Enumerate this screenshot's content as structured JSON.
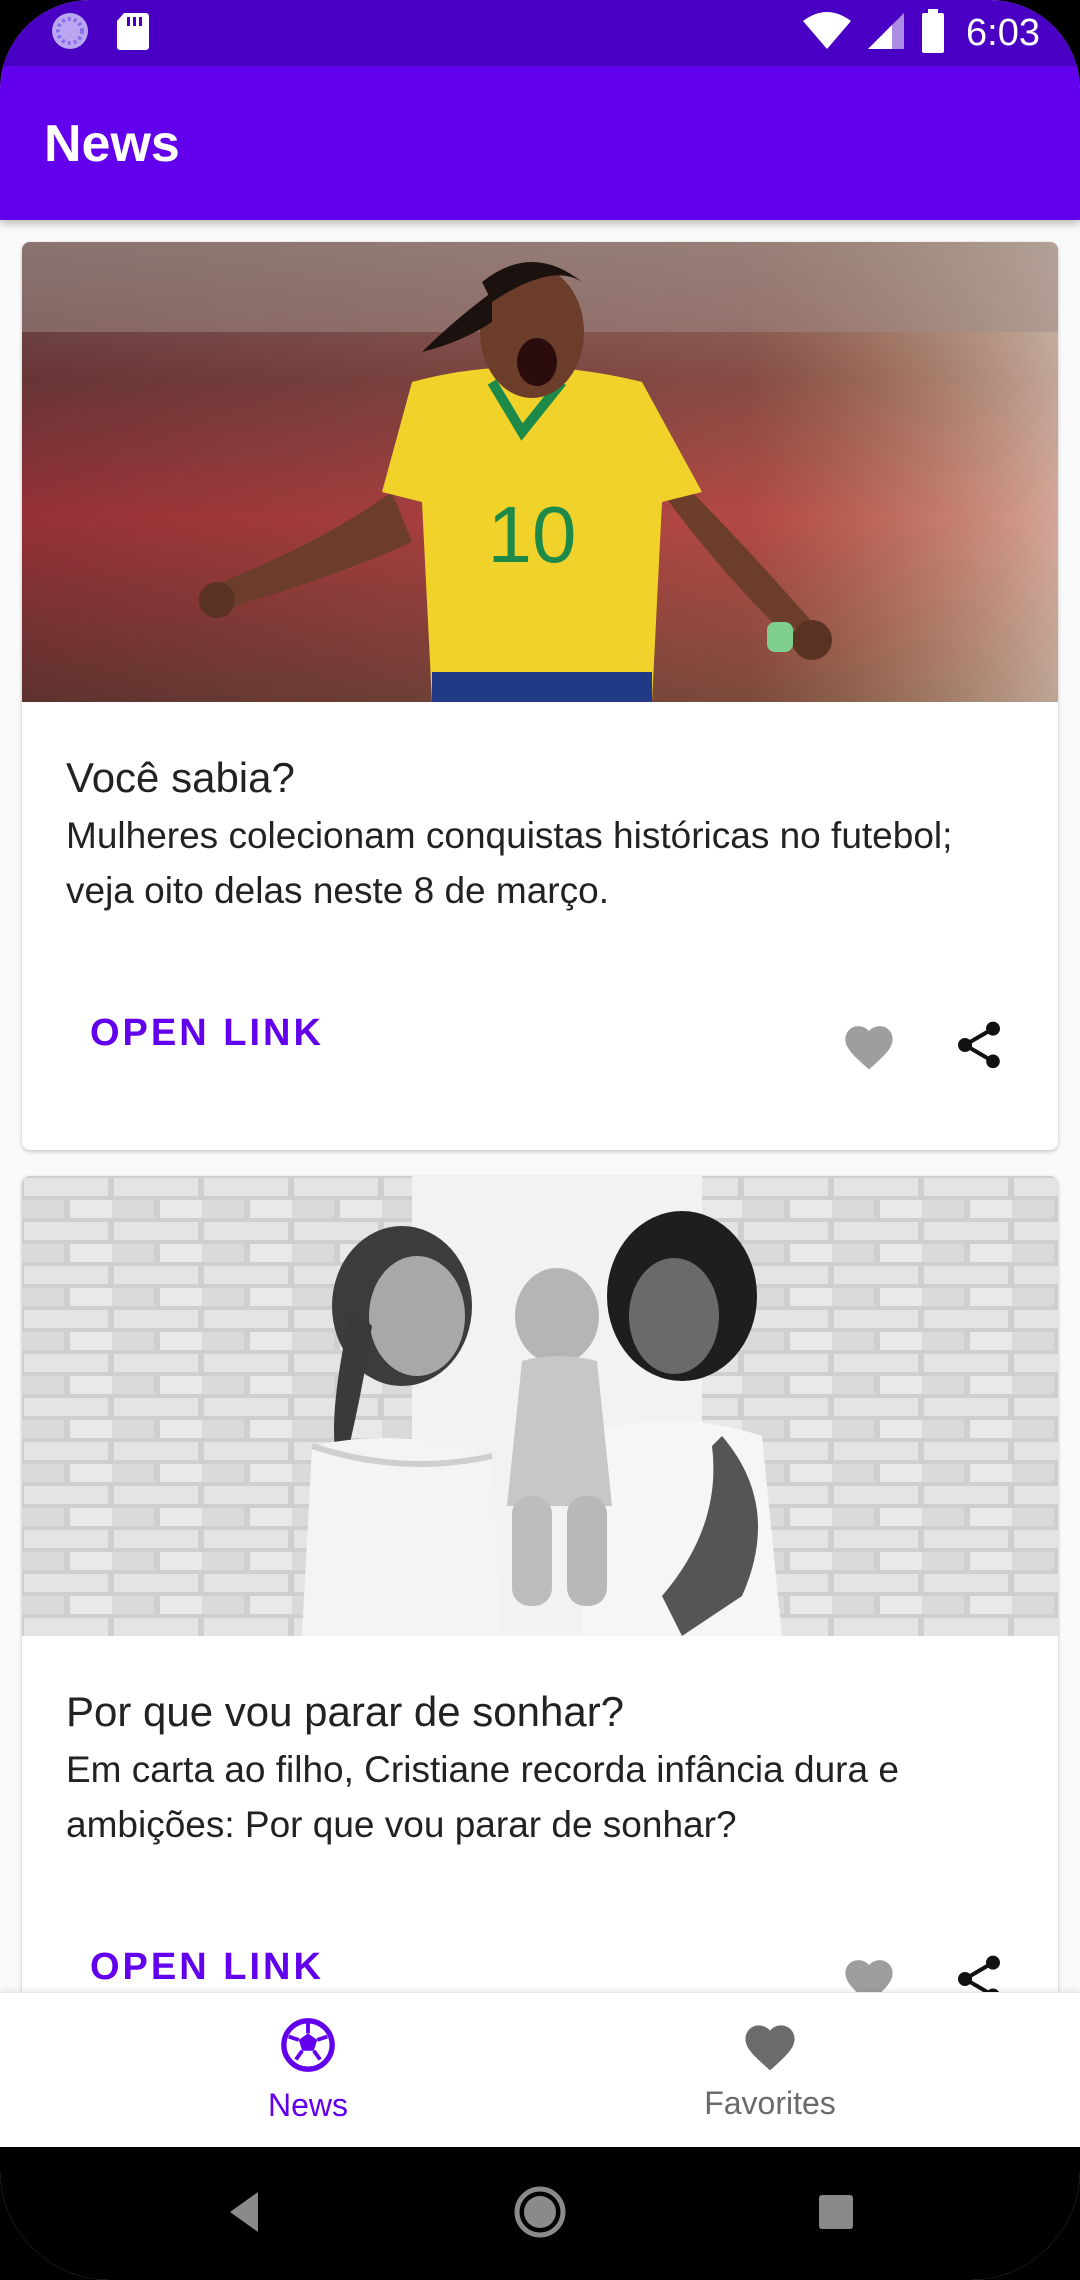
{
  "status_bar": {
    "time": "6:03",
    "icons": [
      "loading-circle-icon",
      "sd-card-icon",
      "wifi-icon",
      "signal-icon",
      "battery-icon"
    ]
  },
  "app_bar": {
    "title": "News"
  },
  "colors": {
    "primary": "#6200ee",
    "primary_dark": "#4a00c4",
    "favorite_inactive": "#9e9e9e",
    "nav_inactive": "#6b6b6b"
  },
  "news": [
    {
      "title": "Você sabia?",
      "description": "Mulheres colecionam conquistas históricas no futebol; veja oito delas neste 8 de março.",
      "open_link_label": "OPEN LINK",
      "image": "woman-footballer-celebrating-photo",
      "jersey_number": "10"
    },
    {
      "title": "Por que vou parar de sonhar?",
      "description": "Em carta ao filho, Cristiane recorda infância dura e ambições: Por que vou parar de sonhar?",
      "open_link_label": "OPEN LINK",
      "image": "family-black-and-white-photo"
    }
  ],
  "bottom_nav": {
    "items": [
      {
        "label": "News",
        "icon": "soccer-ball-icon",
        "active": true
      },
      {
        "label": "Favorites",
        "icon": "heart-icon",
        "active": false
      }
    ]
  },
  "system_nav": {
    "buttons": [
      "back-icon",
      "home-icon",
      "recents-icon"
    ]
  }
}
